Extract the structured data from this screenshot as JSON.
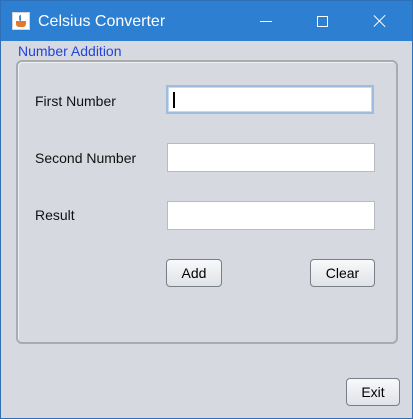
{
  "window": {
    "title": "Celsius Converter",
    "icon": "java-cup-icon",
    "controls": [
      "minimize-icon",
      "maximize-icon",
      "close-icon"
    ]
  },
  "group": {
    "title": "Number Addition"
  },
  "form": {
    "first_label": "First Number",
    "first_value": "",
    "second_label": "Second Number",
    "second_value": "",
    "result_label": "Result",
    "result_value": ""
  },
  "buttons": {
    "add": "Add",
    "clear": "Clear",
    "exit": "Exit"
  },
  "colors": {
    "titlebar": "#2d7fd1",
    "group_title": "#2244dd",
    "window_bg": "#d6d9df"
  }
}
